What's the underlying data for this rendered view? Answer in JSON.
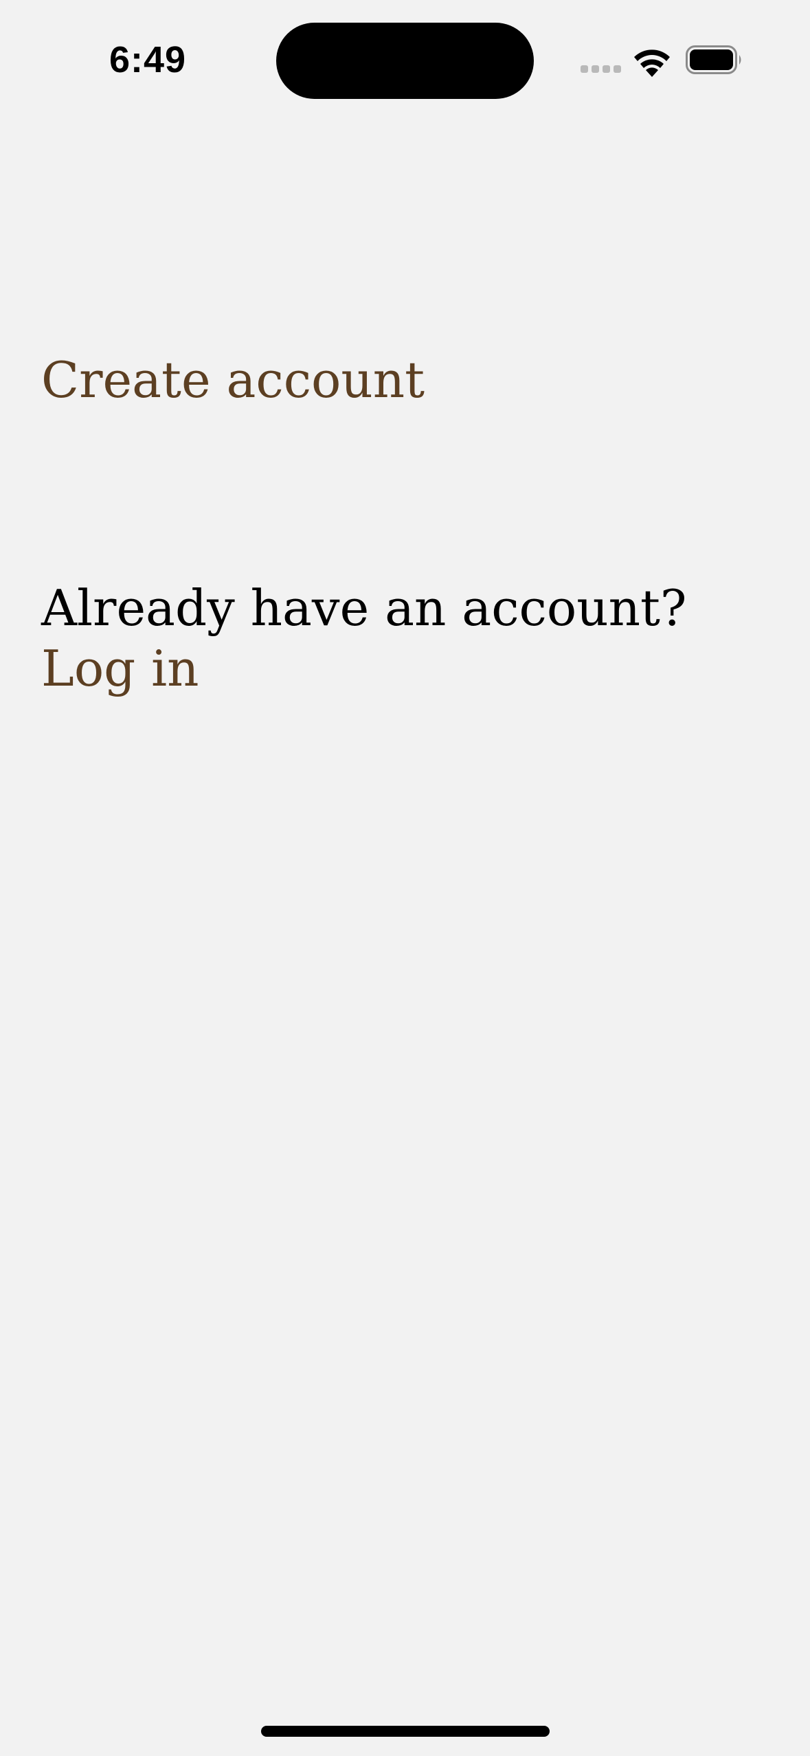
{
  "status_bar": {
    "time": "6:49",
    "icons": [
      "signal-icon",
      "wifi-icon",
      "battery-icon"
    ]
  },
  "main": {
    "create_account_label": "Create account",
    "login_prompt": "Already have an account?",
    "login_label": "Log in"
  },
  "colors": {
    "background": "#f2f2f2",
    "accent": "#5c3f22",
    "text": "#000000"
  }
}
